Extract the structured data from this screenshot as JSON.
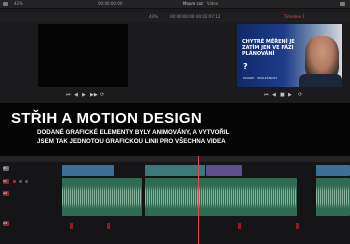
{
  "topbar": {
    "left_zoom": "42%",
    "left_timecode": "00:00:00:00",
    "title": "Moore cut",
    "right_mode": "Video"
  },
  "subbar": {
    "zoom": "43%",
    "tc_in": "00:00:00:00",
    "tc_out": "00:02:07:12",
    "timeline_label": "Timeline 1"
  },
  "thumbnail": {
    "headline": "CHYTRÉ MĚŘENÍ JE ZATÍM JEN VE FÁZI PLÁNOVÁNÍ",
    "mark": "?",
    "footer": "MOORE · SPOLEČNOST"
  },
  "overlay": {
    "title": "STŘIH A MOTION DESIGN",
    "line1": "DODANÉ GRAFICKÉ ELEMENTY BYLY ANIMOVÁNY, A VYTVOŘIL",
    "line2": "JSEM TAK JEDNOTOU GRAFICKOU LINII PRO VŠECHNA VIDEA"
  },
  "tracks": {
    "v1": "V1",
    "a1": "A1",
    "a2": "A2",
    "a3": "A3"
  },
  "colors": {
    "accent": "#e0474f",
    "video_clip": "#3e6f97",
    "audio_clip": "#2f6b53",
    "thumb_blue": "#1d3c8a"
  }
}
